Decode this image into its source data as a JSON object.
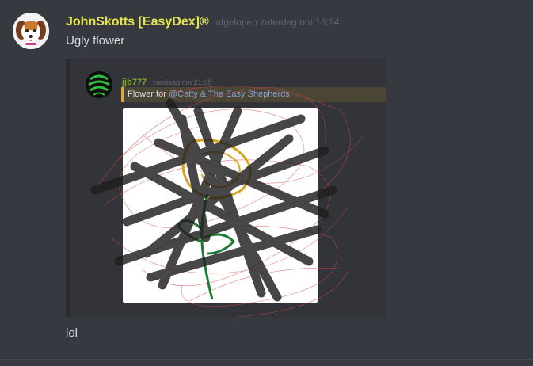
{
  "message": {
    "username": "JohnSkotts [EasyDex]®",
    "timestamp": "afgelopen zaterdag om 18:24",
    "text": "Ugly flower",
    "followup_text": "lol"
  },
  "embed": {
    "author": "jjb777",
    "timestamp": "vandaag om 21:38",
    "text_prefix": "Flower for",
    "mention": "@Catty & The Easy Shepherds"
  },
  "colors": {
    "background": "#36393f",
    "username": "#e6e64a",
    "embed_author": "#7fa42c",
    "mention": "#8f9fd8",
    "mention_accent": "#e2a62b"
  },
  "icons": {
    "avatar": "beagle-dog-avatar",
    "embed_avatar": "green-swirl-avatar"
  }
}
